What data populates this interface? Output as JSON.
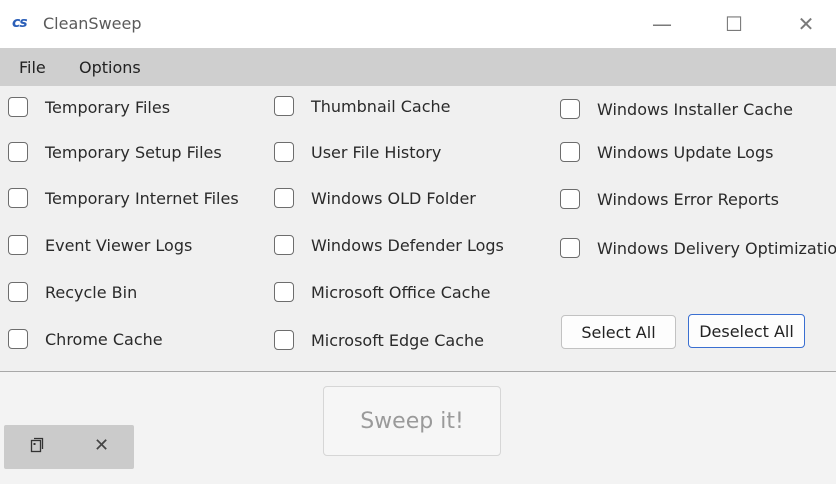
{
  "window": {
    "logo_text": "cs",
    "title": "CleanSweep",
    "controls": {
      "minimize": "—",
      "maximize": "☐",
      "close": "✕"
    }
  },
  "menu": {
    "file": "File",
    "options": "Options"
  },
  "checkboxes": {
    "col1": [
      {
        "label": "Temporary Files",
        "checked": false
      },
      {
        "label": "Temporary Setup Files",
        "checked": false
      },
      {
        "label": "Temporary Internet Files",
        "checked": false
      },
      {
        "label": "Event Viewer Logs",
        "checked": false
      },
      {
        "label": "Recycle Bin",
        "checked": false
      },
      {
        "label": "Chrome Cache",
        "checked": false
      }
    ],
    "col2": [
      {
        "label": "Thumbnail Cache",
        "checked": false
      },
      {
        "label": "User File History",
        "checked": false
      },
      {
        "label": "Windows OLD Folder",
        "checked": false
      },
      {
        "label": "Windows Defender Logs",
        "checked": false
      },
      {
        "label": "Microsoft Office Cache",
        "checked": false
      },
      {
        "label": "Microsoft Edge Cache",
        "checked": false
      }
    ],
    "col3": [
      {
        "label": "Windows Installer Cache",
        "checked": false
      },
      {
        "label": "Windows Update Logs",
        "checked": false
      },
      {
        "label": "Windows Error Reports",
        "checked": false
      },
      {
        "label": "Windows Delivery Optimization",
        "checked": false
      }
    ]
  },
  "actions": {
    "select_all": "Select All",
    "deselect_all": "Deselect All"
  },
  "sweep": {
    "label": "Sweep it!"
  },
  "taskbar_chip": {
    "icon": "document-icon",
    "close": "✕"
  },
  "colors": {
    "accent": "#3a6fd1",
    "menubar": "#cfcfcf",
    "content_bg": "#f0f0f0"
  }
}
